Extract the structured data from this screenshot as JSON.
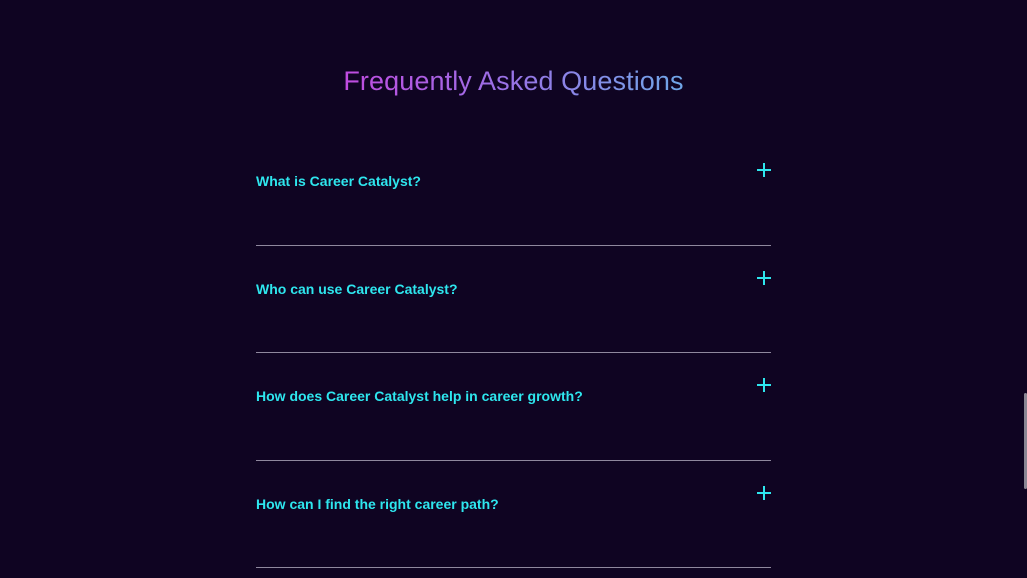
{
  "faq": {
    "title": "Frequently Asked Questions",
    "items": [
      {
        "question": "What is Career Catalyst?",
        "toggle_icon": "plus-icon"
      },
      {
        "question": "Who can use Career Catalyst?",
        "toggle_icon": "plus-icon"
      },
      {
        "question": "How does Career Catalyst help in career growth?",
        "toggle_icon": "plus-icon"
      },
      {
        "question": "How can I find the right career path?",
        "toggle_icon": "plus-icon"
      }
    ]
  },
  "colors": {
    "background": "#0f0422",
    "question_text": "#2ee6ee",
    "title_gradient_start": "#c04be0",
    "title_gradient_end": "#6fa7e8",
    "divider": "#8f889e"
  }
}
